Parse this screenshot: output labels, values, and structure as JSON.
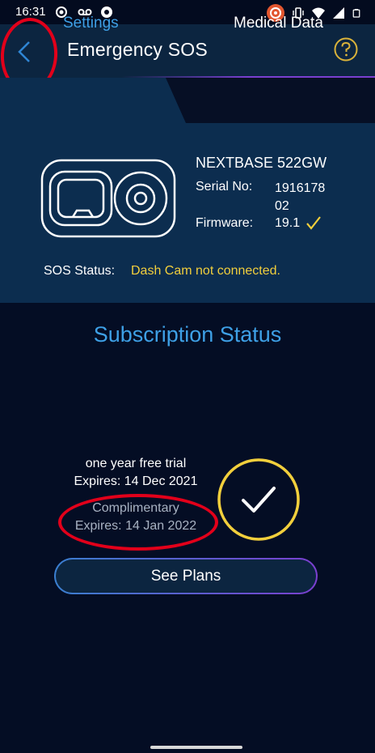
{
  "status_bar": {
    "time": "16:31",
    "left_icons": [
      "target-icon",
      "voicemail-icon",
      "chrome-icon"
    ],
    "right_icons": [
      "media-app-icon",
      "vibrate-icon",
      "wifi-icon",
      "signal-icon",
      "battery-icon"
    ]
  },
  "app_bar": {
    "title": "Emergency SOS",
    "back_icon": "back-chevron-icon",
    "help_icon": "question-circle-icon"
  },
  "tabs": [
    {
      "label": "Settings",
      "active": true
    },
    {
      "label": "Medical Data",
      "active": false
    }
  ],
  "device": {
    "name": "NEXTBASE 522GW",
    "serial_label": "Serial No:",
    "serial_value": "191617802",
    "firmware_label": "Firmware:",
    "firmware_value": "19.1",
    "sos_label": "SOS Status:",
    "sos_value": "Dash Cam not connected."
  },
  "subscription": {
    "heading": "Subscription Status",
    "plan_name": "one year free trial",
    "plan_expiry": "Expires: 14 Dec 2021",
    "complimentary_name": "Complimentary",
    "complimentary_expiry": "Expires: 14 Jan 2022",
    "see_plans_label": "See Plans"
  },
  "colors": {
    "background": "#040d24",
    "panel": "#0c2d4f",
    "accent_blue": "#3ea0e6",
    "accent_yellow": "#f2cf3c",
    "annotation_red": "#e2001a"
  }
}
